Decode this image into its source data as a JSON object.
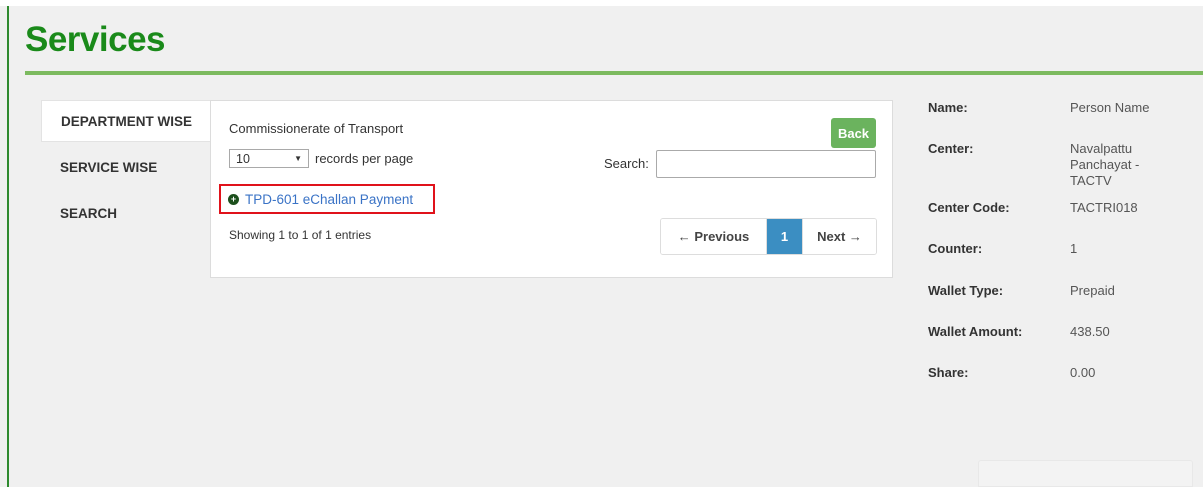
{
  "page": {
    "title": "Services"
  },
  "tabs": [
    {
      "label": "DEPARTMENT WISE",
      "active": true
    },
    {
      "label": "SERVICE WISE",
      "active": false
    },
    {
      "label": "SEARCH",
      "active": false
    }
  ],
  "panel": {
    "department": "Commissionerate of Transport",
    "back_label": "Back",
    "page_length": "10",
    "page_length_suffix": "records per page",
    "search_label": "Search:",
    "search_value": "",
    "service_item": "TPD-601 eChallan Payment",
    "info": "Showing 1 to 1 of 1 entries",
    "pager": {
      "previous": "← Previous",
      "current": "1",
      "next": "Next →"
    }
  },
  "user_info": {
    "name_label": "Name:",
    "name_value": "Person Name",
    "center_label": "Center:",
    "center_value_1": "Navalpattu",
    "center_value_2": "Panchayat -",
    "center_value_3": "TACTV",
    "center_code_label": "Center Code:",
    "center_code_value": "TACTRI018",
    "counter_label": "Counter:",
    "counter_value": "1",
    "wallet_type_label": "Wallet Type:",
    "wallet_type_value": "Prepaid",
    "wallet_amount_label": "Wallet Amount:",
    "wallet_amount_value": "438.50",
    "share_label": "Share:",
    "share_value": "0.00"
  },
  "colors": {
    "brand_green": "#1a8a1a",
    "rule_green": "#7cba5f",
    "link_blue": "#3a73c6",
    "highlight_red": "#e0121b",
    "pager_blue": "#3b8ec2"
  }
}
